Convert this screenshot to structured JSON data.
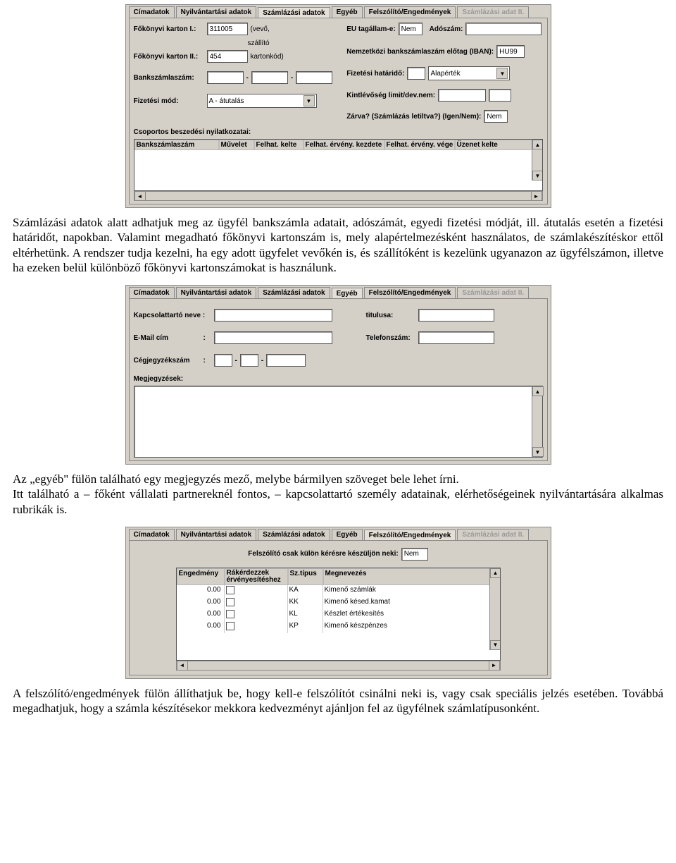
{
  "tabs": {
    "t1": "Címadatok",
    "t2": "Nyilvántartási adatok",
    "t3": "Számlázási adatok",
    "t4": "Egyéb",
    "t5": "Felszólító/Engedmények",
    "t6": "Számlázási adat II."
  },
  "billing": {
    "fokonyvi1_label": "Főkönyvi karton I.:",
    "fokonyvi1_value": "311005",
    "fokonyvi2_label": "Főkönyvi karton II.:",
    "fokonyvi2_value": "454",
    "kartonkod_note1": "(vevő,",
    "kartonkod_note2": "szállító",
    "kartonkod_note3": "kartonkód)",
    "bankszamla_label": "Bankszámlaszám:",
    "dash": "-",
    "fizetesimod_label": "Fizetési mód:",
    "fizetesimod_value": "A - átutalás",
    "eu_label": "EU tagállam-e:",
    "eu_value": "Nem",
    "adoszam_label": "Adószám:",
    "iban_label": "Nemzetközi bankszámlaszám előtag (IBAN):",
    "iban_value": "HU99",
    "fizhat_label": "Fizetési határidő:",
    "fizhat_value": "Alapérték",
    "kintlev_label": "Kintlévőség limit/dev.nem:",
    "zarva_label": "Zárva? (Számlázás letiltva?) (Igen/Nem):",
    "zarva_value": "Nem",
    "csoportos_label": "Csoportos beszedési nyilatkozatai:",
    "gridcols": {
      "c1": "Bankszámlaszám",
      "c2": "Művelet",
      "c3": "Felhat. kelte",
      "c4": "Felhat. érvény. kezdete",
      "c5": "Felhat. érvény. vége",
      "c6": "Üzenet kelte"
    }
  },
  "para1": "Számlázási adatok alatt adhatjuk meg az ügyfél bankszámla adatait, adószámát, egyedi fizetési módját, ill. átutalás esetén a fizetési határidőt, napokban. Valamint megadható főkönyvi kartonszám is, mely alapértelmezésként használatos, de számlakészítéskor ettől eltérhetünk. A rendszer tudja kezelni, ha egy adott ügyfelet vevőkén is, és szállítóként is kezelünk ugyanazon az ügyfélszámon, illetve ha ezeken belül különböző főkönyvi kartonszámokat is használunk.",
  "egyeb": {
    "kapcs_label": "Kapcsolattartó neve :",
    "titulus_label": "titulusa:",
    "email_label": "E-Mail cím",
    "colon": ":",
    "tel_label": "Telefonszám:",
    "cegj_label": "Cégjegyzékszám",
    "megj_label": "Megjegyzések:"
  },
  "para2": "Az „egyéb\" fülön található egy megjegyzés mező, melybe bármilyen szöveget bele lehet írni.",
  "para2b": "Itt található a – főként vállalati partnereknél fontos, – kapcsolattartó személy adatainak, elérhetőségeinek nyilvántartására alkalmas rubrikák is.",
  "felszolito": {
    "felsz_label": "Felszólító csak külön kérésre készüljön neki:",
    "felsz_value": "Nem",
    "gridcols": {
      "c1": "Engedmény",
      "c2a": "Rákérdezzek",
      "c2b": "érvényesítéshez",
      "c3": "Sz.típus",
      "c4": "Megnevezés"
    },
    "rows": [
      {
        "eng": "0.00",
        "tip": "KA",
        "meg": "Kimenő számlák"
      },
      {
        "eng": "0.00",
        "tip": "KK",
        "meg": "Kimenő késed.kamat"
      },
      {
        "eng": "0.00",
        "tip": "KL",
        "meg": "Készlet értékesítés"
      },
      {
        "eng": "0.00",
        "tip": "KP",
        "meg": "Kimenő készpénzes"
      }
    ]
  },
  "para3": "A felszólító/engedmények fülön állíthatjuk be, hogy kell-e felszólítót csinálni neki is, vagy csak speciális jelzés esetében. Továbbá megadhatjuk, hogy a számla készítésekor mekkora kedvezményt ajánljon fel az ügyfélnek számlatípusonként."
}
